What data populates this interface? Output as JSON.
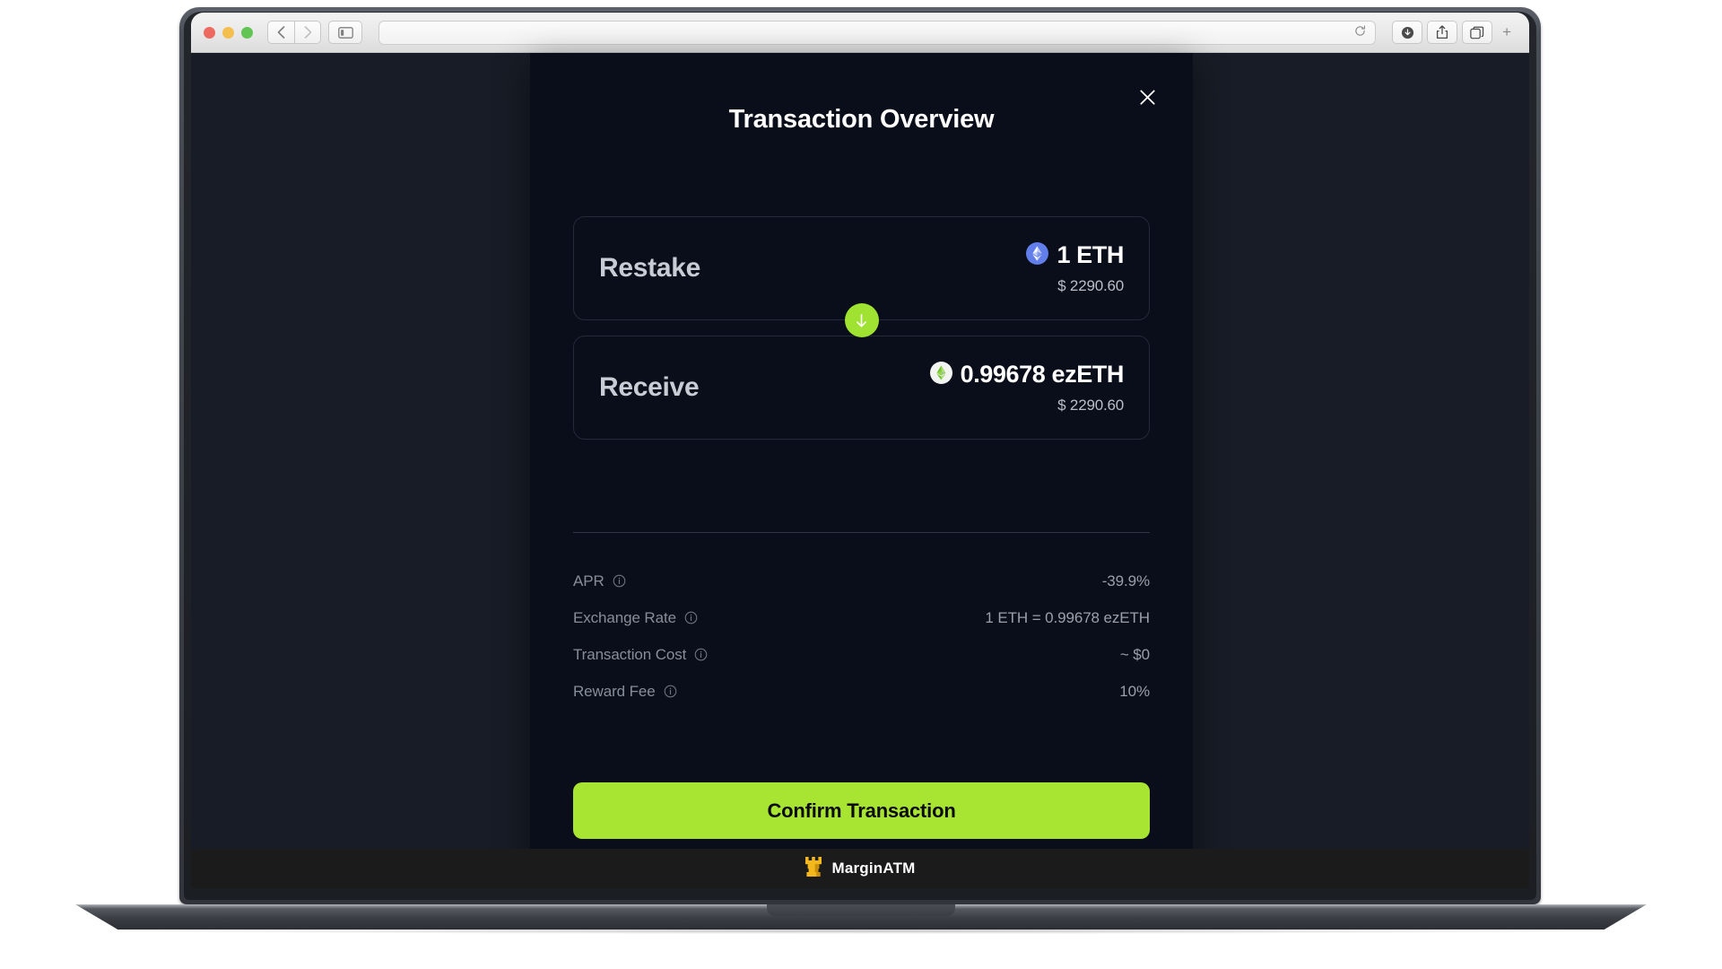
{
  "browser": {
    "traffic_lights": [
      "close",
      "minimize",
      "maximize"
    ],
    "back_label": "‹",
    "forward_label": "›",
    "sidebar_icon": "sidebar-icon",
    "address_value": "",
    "address_placeholder": "",
    "reload_icon": "reload-icon",
    "downloads_icon": "downloads-icon",
    "share_icon": "share-icon",
    "tabs_icon": "tab-overview-icon",
    "new_tab_label": "+"
  },
  "watermark": {
    "brand": "MarginATM",
    "logo_icon": "rook-logo-icon"
  },
  "modal": {
    "title": "Transaction Overview",
    "close_icon": "close-icon",
    "swap": {
      "arrow_icon": "arrow-down-icon",
      "rows": [
        {
          "label": "Restake",
          "token_icon": "eth-token-icon",
          "amount": "1 ETH",
          "usd": "$ 2290.60"
        },
        {
          "label": "Receive",
          "token_icon": "ezeth-token-icon",
          "amount": "0.99678 ezETH",
          "usd": "$ 2290.60"
        }
      ]
    },
    "details": [
      {
        "label": "APR",
        "info_icon": "info-icon",
        "value": "-39.9%"
      },
      {
        "label": "Exchange Rate",
        "info_icon": "info-icon",
        "value": "1 ETH = 0.99678 ezETH"
      },
      {
        "label": "Transaction Cost",
        "info_icon": "info-icon",
        "value": "~ $0"
      },
      {
        "label": "Reward Fee",
        "info_icon": "info-icon",
        "value": "10%"
      }
    ],
    "confirm_label": "Confirm Transaction"
  },
  "colors": {
    "accent_green": "#a8e533",
    "badge_green": "#9fe231",
    "modal_bg": "#0a0e1a",
    "page_bg": "#171c26",
    "eth_blue": "#627eea",
    "brand_gold": "#f5b81c"
  }
}
